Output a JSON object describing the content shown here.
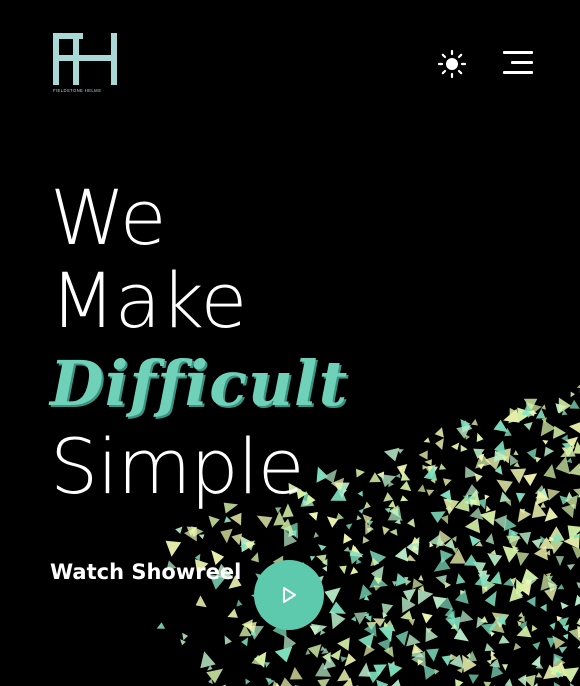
{
  "header": {
    "logo_mark": "FH",
    "logo_tagline": "FIELDSTONE HELMS",
    "theme_icon": "sun-icon",
    "menu_icon": "hamburger-menu-icon"
  },
  "hero": {
    "line1": "We",
    "line2": "Make",
    "line3": "Difficult",
    "line4": "Simple"
  },
  "cta": {
    "label": "Watch Showreel",
    "icon": "play-icon"
  },
  "colors": {
    "background": "#000000",
    "accent": "#5dc9ad",
    "accent_text": "#6fd1b8",
    "logo": "#a9d9d6",
    "particle_a": "#7fe0c0",
    "particle_b": "#f0f7b0"
  }
}
